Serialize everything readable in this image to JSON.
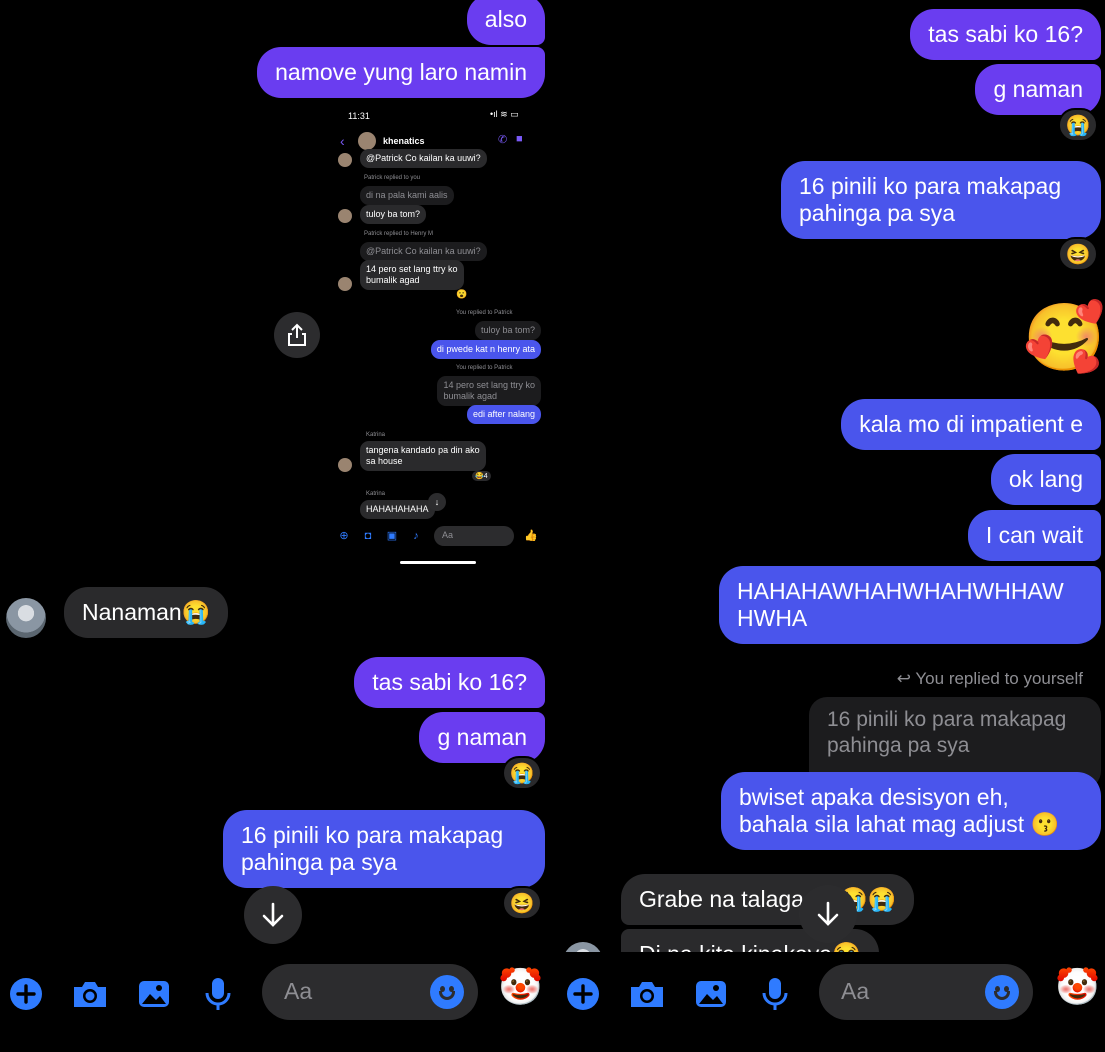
{
  "left": {
    "messages": {
      "also": "also",
      "namove": "namove yung laro namin",
      "nanaman": "Nanaman😭",
      "tas_sabi": "tas sabi ko 16?",
      "g_naman": "g naman",
      "pinili_line1": "16 pinili ko para makapag",
      "pinili_line2": "pahinga pa sya"
    },
    "reactions": {
      "g_naman": "😭",
      "pinili": "😆"
    }
  },
  "embedded": {
    "time": "11:31",
    "contact": "khenatics",
    "msg1": "@Patrick Co kailan ka uuwi?",
    "reply1": "Patrick replied to you",
    "msg2": "di na pala kami aalis",
    "msg3": "tuloy ba tom?",
    "reply2": "Patrick replied to Henry M",
    "msg4": "@Patrick Co kailan ka uuwi?",
    "msg5a": "14 pero set lang ttry ko",
    "msg5b": "bumalik agad",
    "reply3": "You replied to Patrick",
    "msg6": "tuloy ba tom?",
    "msg7": "di pwede kat n henry ata",
    "reply4": "You replied to Patrick",
    "msg8a": "14 pero set lang ttry ko",
    "msg8b": "bumalik agad",
    "msg9": "edi after nalang",
    "sender1": "Katrina",
    "msg10a": "tangena kandado pa din ako",
    "msg10b": "sa house",
    "react10": "😂4",
    "sender2": "Katrina",
    "msg11": "HAHAHAHAHA",
    "input_placeholder": "Aa"
  },
  "right": {
    "messages": {
      "tas_sabi": "tas sabi ko 16?",
      "g_naman": "g naman",
      "pinili_line1": "16 pinili ko para makapag",
      "pinili_line2": "pahinga pa sya",
      "big_emoji": "🥰",
      "kala_mo": "kala mo di impatient e",
      "ok_lang": "ok lang",
      "i_can_wait": "I can wait",
      "haha_line1": "HAHAHAWHAHWHAHWHHAW",
      "haha_line2": "HWHA",
      "replied_label": "You replied to yourself",
      "quote_line1": "16 pinili ko para makapag",
      "quote_line2": "pahinga pa sya",
      "bwiset_line1": "bwiset apaka desisyon eh,",
      "bwiset_line2": "bahala sila lahat mag adjust 😗",
      "grabe": "Grabe na talaga 😭😭😭",
      "di_na_kita": "Di na kita kinakaya😭"
    },
    "reactions": {
      "g_naman": "😭",
      "pinili": "😆"
    }
  },
  "composer": {
    "placeholder": "Aa",
    "quick_reaction": "🤡"
  }
}
